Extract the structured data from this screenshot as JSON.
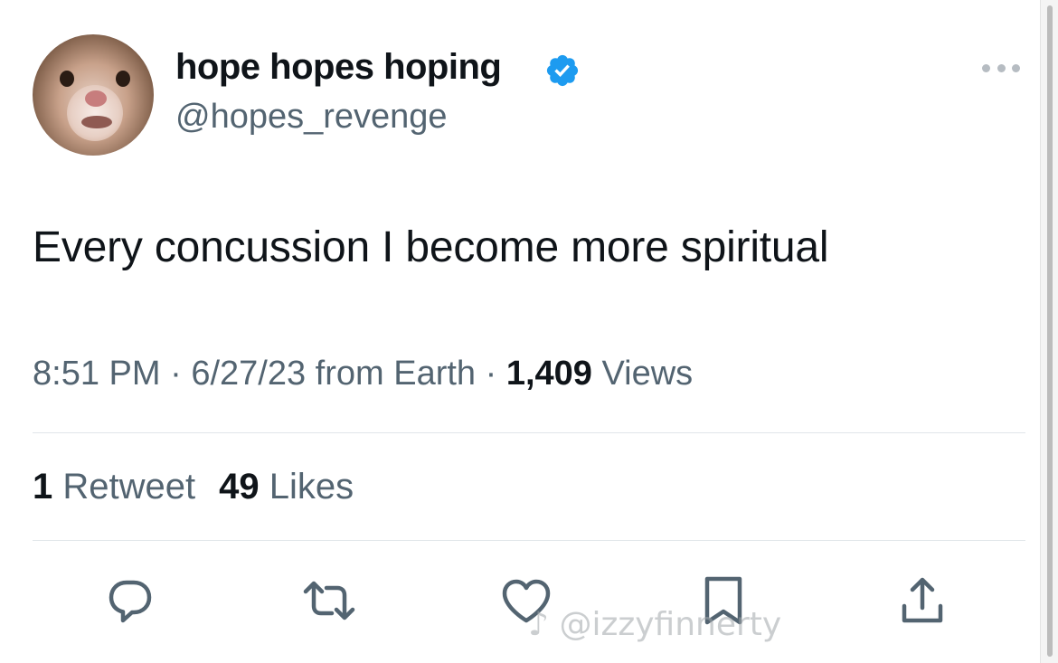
{
  "author": {
    "display_name": "hope hopes hoping",
    "handle": "@hopes_revenge",
    "verified": true,
    "verified_color": "#1d9bf0"
  },
  "tweet": {
    "text": "Every concussion I become more spiritual"
  },
  "meta": {
    "time": "8:51 PM",
    "separator": "·",
    "date": "6/27/23",
    "source": "from Earth",
    "views_count": "1,409",
    "views_label": "Views"
  },
  "stats": {
    "retweets_count": "1",
    "retweets_label": "Retweet",
    "likes_count": "49",
    "likes_label": "Likes"
  },
  "actions": [
    {
      "name": "reply",
      "icon": "reply-icon"
    },
    {
      "name": "retweet",
      "icon": "retweet-icon"
    },
    {
      "name": "like",
      "icon": "heart-icon"
    },
    {
      "name": "bookmark",
      "icon": "bookmark-icon"
    },
    {
      "name": "share",
      "icon": "share-icon"
    }
  ],
  "watermark": {
    "icon": "tiktok-icon",
    "text": "@izzyfinnerty"
  },
  "colors": {
    "text_primary": "#0f1419",
    "text_secondary": "#536471",
    "divider": "#e1e6ea",
    "action_icon": "#536471"
  }
}
